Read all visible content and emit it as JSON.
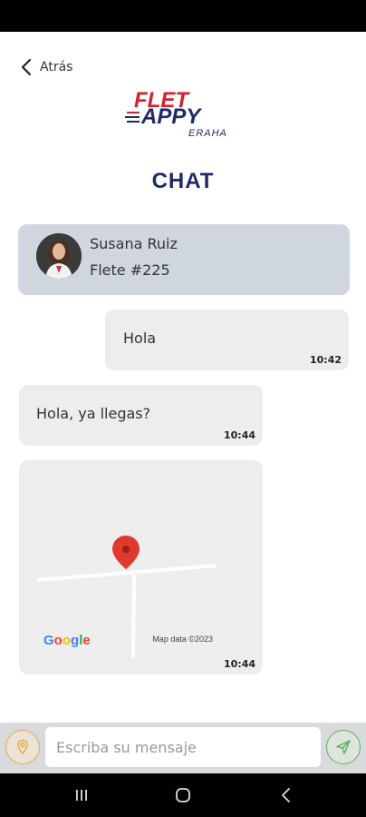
{
  "header": {
    "back_label": "Atrás",
    "title": "CHAT"
  },
  "logo": {
    "line1": "FLET",
    "line2": "APPY",
    "line3": "ERAHA"
  },
  "contact": {
    "name": "Susana Ruiz",
    "subtitle": "Flete #225"
  },
  "messages": [
    {
      "side": "outgoing",
      "text": "Hola",
      "time": "10:42"
    },
    {
      "side": "incoming",
      "text": "Hola, ya llegas?",
      "time": "10:44"
    },
    {
      "side": "incoming",
      "type": "map",
      "time": "10:44",
      "map_attribution": "Map data ©2023",
      "map_brand": "Google"
    }
  ],
  "composer": {
    "placeholder": "Escriba su mensaje",
    "value": "",
    "location_icon": "location-pin-icon",
    "send_icon": "send-icon"
  },
  "colors": {
    "title": "#1f2a6b",
    "card": "#d0d6de",
    "bubble": "#ededed",
    "location_accent": "#f0a54a",
    "send_accent": "#5fb35f",
    "logo_red": "#d3212f",
    "logo_blue": "#1f2a6b"
  }
}
